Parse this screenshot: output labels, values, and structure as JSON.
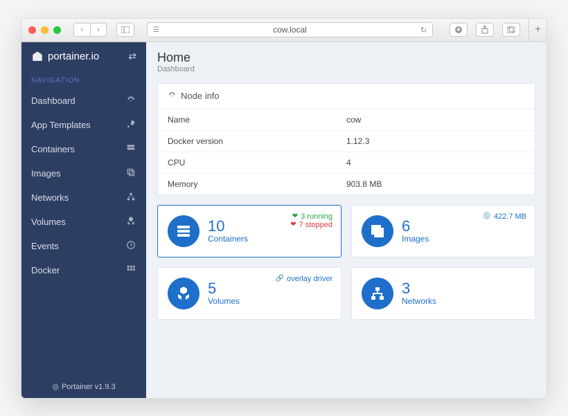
{
  "browser": {
    "url": "cow.local"
  },
  "brand": {
    "text": "portainer.io"
  },
  "nav": {
    "header": "NAVIGATION",
    "items": [
      {
        "label": "Dashboard"
      },
      {
        "label": "App Templates"
      },
      {
        "label": "Containers"
      },
      {
        "label": "Images"
      },
      {
        "label": "Networks"
      },
      {
        "label": "Volumes"
      },
      {
        "label": "Events"
      },
      {
        "label": "Docker"
      }
    ]
  },
  "footer": {
    "text": "Portainer v1.9.3"
  },
  "page": {
    "title": "Home",
    "sub": "Dashboard"
  },
  "node": {
    "panel_title": "Node info",
    "rows": {
      "name_k": "Name",
      "name_v": "cow",
      "dv_k": "Docker version",
      "dv_v": "1.12.3",
      "cpu_k": "CPU",
      "cpu_v": "4",
      "mem_k": "Memory",
      "mem_v": "903.8 MB"
    }
  },
  "cards": {
    "containers": {
      "count": "10",
      "label": "Containers",
      "running": "3 running",
      "stopped": "7 stopped"
    },
    "images": {
      "count": "6",
      "label": "Images",
      "size": "422.7 MB"
    },
    "volumes": {
      "count": "5",
      "label": "Volumes",
      "driver": "overlay driver"
    },
    "networks": {
      "count": "3",
      "label": "Networks"
    }
  }
}
